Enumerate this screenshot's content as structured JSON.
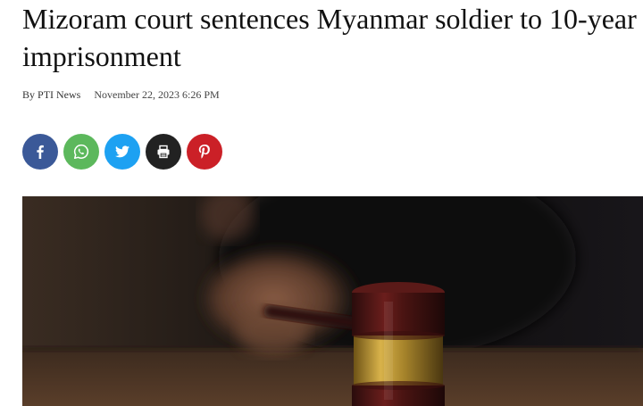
{
  "article": {
    "title": "Mizoram court sentences Myanmar soldier to 10-year imprisonment",
    "byline_prefix": "By ",
    "author": "PTI News",
    "date": "November 22, 2023 6:26 PM"
  },
  "share": [
    {
      "name": "facebook",
      "icon": "facebook-icon",
      "color": "#3b5998"
    },
    {
      "name": "whatsapp",
      "icon": "whatsapp-icon",
      "color": "#5cb85c"
    },
    {
      "name": "twitter",
      "icon": "twitter-icon",
      "color": "#1da1f2"
    },
    {
      "name": "print",
      "icon": "print-icon",
      "color": "#222222"
    },
    {
      "name": "pinterest",
      "icon": "pinterest-icon",
      "color": "#cb2027"
    }
  ],
  "hero_image": {
    "subject": "gavel-photo"
  }
}
